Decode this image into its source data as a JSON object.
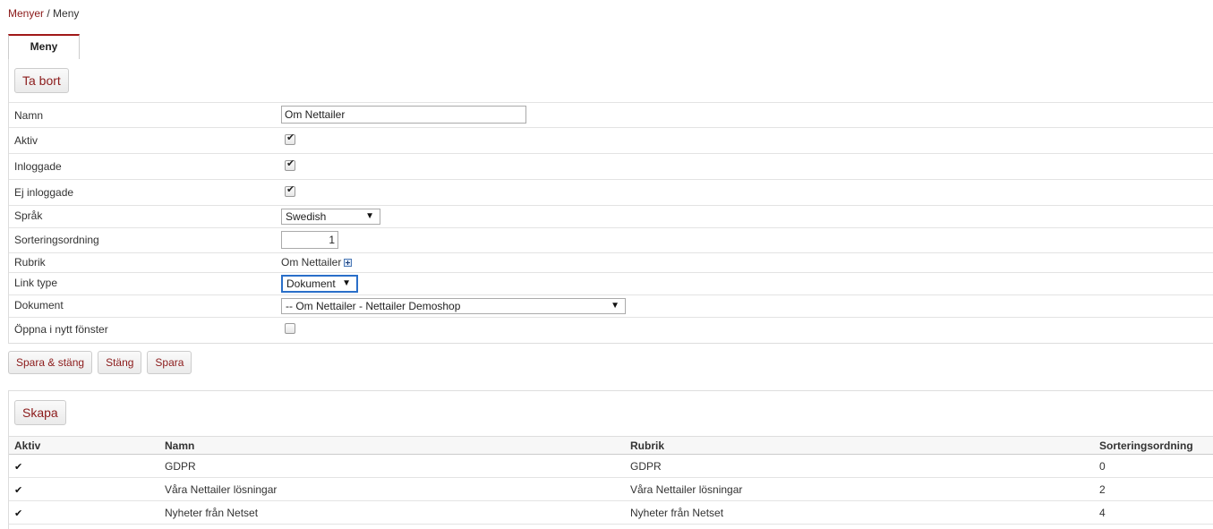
{
  "breadcrumb": {
    "parent": "Menyer",
    "separator": " / ",
    "current": "Meny"
  },
  "tabs": [
    {
      "label": "Meny"
    }
  ],
  "form": {
    "delete_label": "Ta bort",
    "fields": {
      "name": {
        "label": "Namn",
        "value": "Om Nettailer"
      },
      "active": {
        "label": "Aktiv",
        "checked": true
      },
      "logged_in": {
        "label": "Inloggade",
        "checked": true
      },
      "not_logged_in": {
        "label": "Ej inloggade",
        "checked": true
      },
      "language": {
        "label": "Språk",
        "value": "Swedish"
      },
      "sort_order": {
        "label": "Sorteringsordning",
        "value": "1"
      },
      "heading": {
        "label": "Rubrik",
        "value": "Om Nettailer"
      },
      "link_type": {
        "label": "Link type",
        "value": "Dokument"
      },
      "document": {
        "label": "Dokument",
        "value": "-- Om Nettailer - Nettailer Demoshop"
      },
      "new_window": {
        "label": "Öppna i nytt fönster",
        "checked": false
      }
    }
  },
  "actions": {
    "save_close": "Spara & stäng",
    "close": "Stäng",
    "save": "Spara"
  },
  "list": {
    "create_label": "Skapa",
    "columns": {
      "active": "Aktiv",
      "name": "Namn",
      "heading": "Rubrik",
      "sort": "Sorteringsordning"
    },
    "rows": [
      {
        "active": "✔",
        "name": "GDPR",
        "heading": "GDPR",
        "sort": "0"
      },
      {
        "active": "✔",
        "name": "Våra Nettailer lösningar",
        "heading": "Våra Nettailer lösningar",
        "sort": "2"
      },
      {
        "active": "✔",
        "name": "Nyheter från Netset",
        "heading": "Nyheter från Netset",
        "sort": "4"
      }
    ]
  },
  "colors": {
    "accent": "#8b1a1a",
    "tab_border": "#a01818"
  },
  "icons": {
    "checkmark": "check-icon",
    "dropdown": "chevron-down-icon",
    "expand": "plus-icon"
  }
}
